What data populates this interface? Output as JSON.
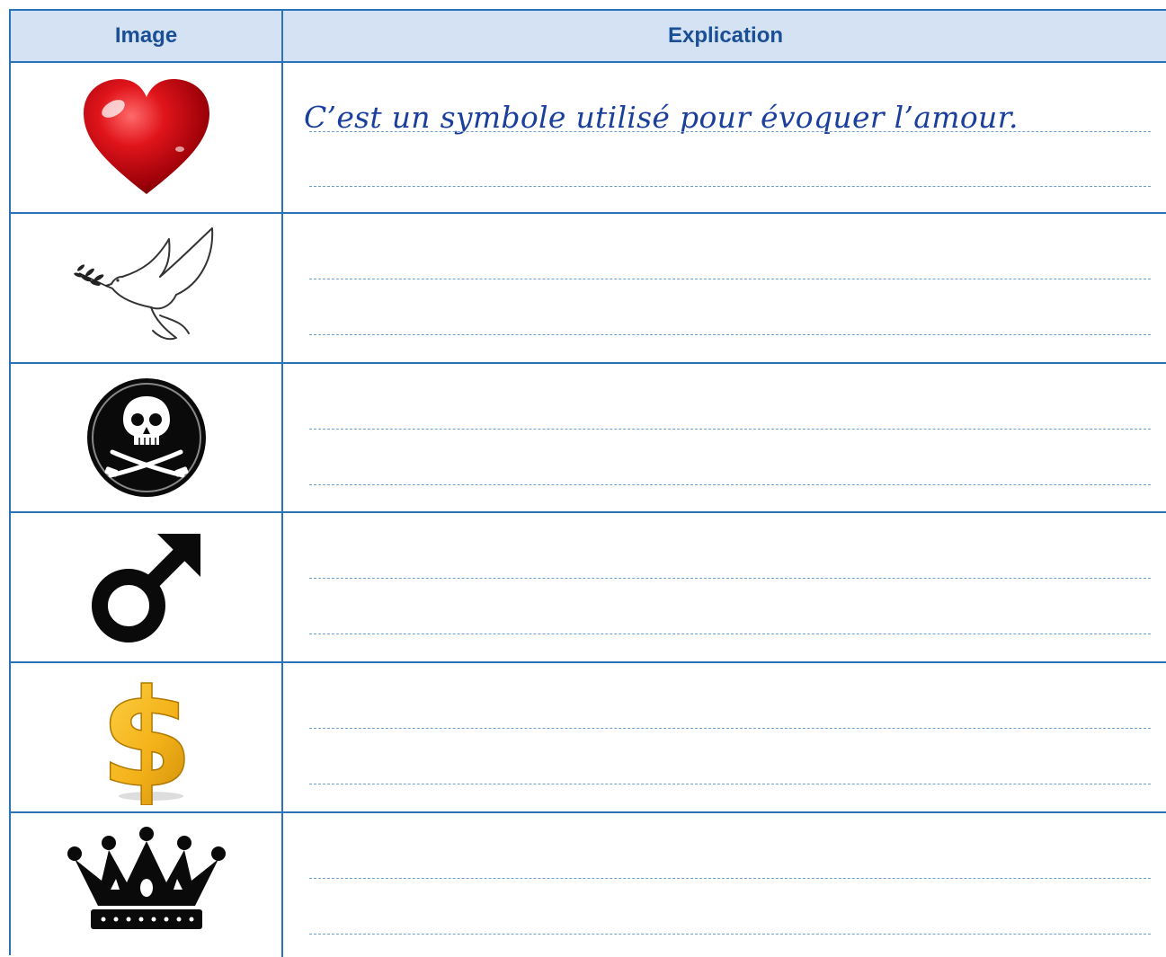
{
  "table": {
    "header_image": "Image",
    "header_explanation": "Explication",
    "rows": [
      {
        "icon": "heart-icon",
        "explanation": "C’est un symbole utilisé pour évoquer l’amour."
      },
      {
        "icon": "dove-icon",
        "explanation": ""
      },
      {
        "icon": "pirate-skull-icon",
        "explanation": ""
      },
      {
        "icon": "male-symbol-icon",
        "explanation": ""
      },
      {
        "icon": "dollar-icon",
        "explanation": ""
      },
      {
        "icon": "crown-icon",
        "explanation": ""
      }
    ]
  },
  "colors": {
    "border": "#2a73b8",
    "header_background": "#d5e2f3",
    "header_text": "#1a4f95",
    "handwriting": "#1b3f9c",
    "dashed_line": "#6f9fcc"
  }
}
